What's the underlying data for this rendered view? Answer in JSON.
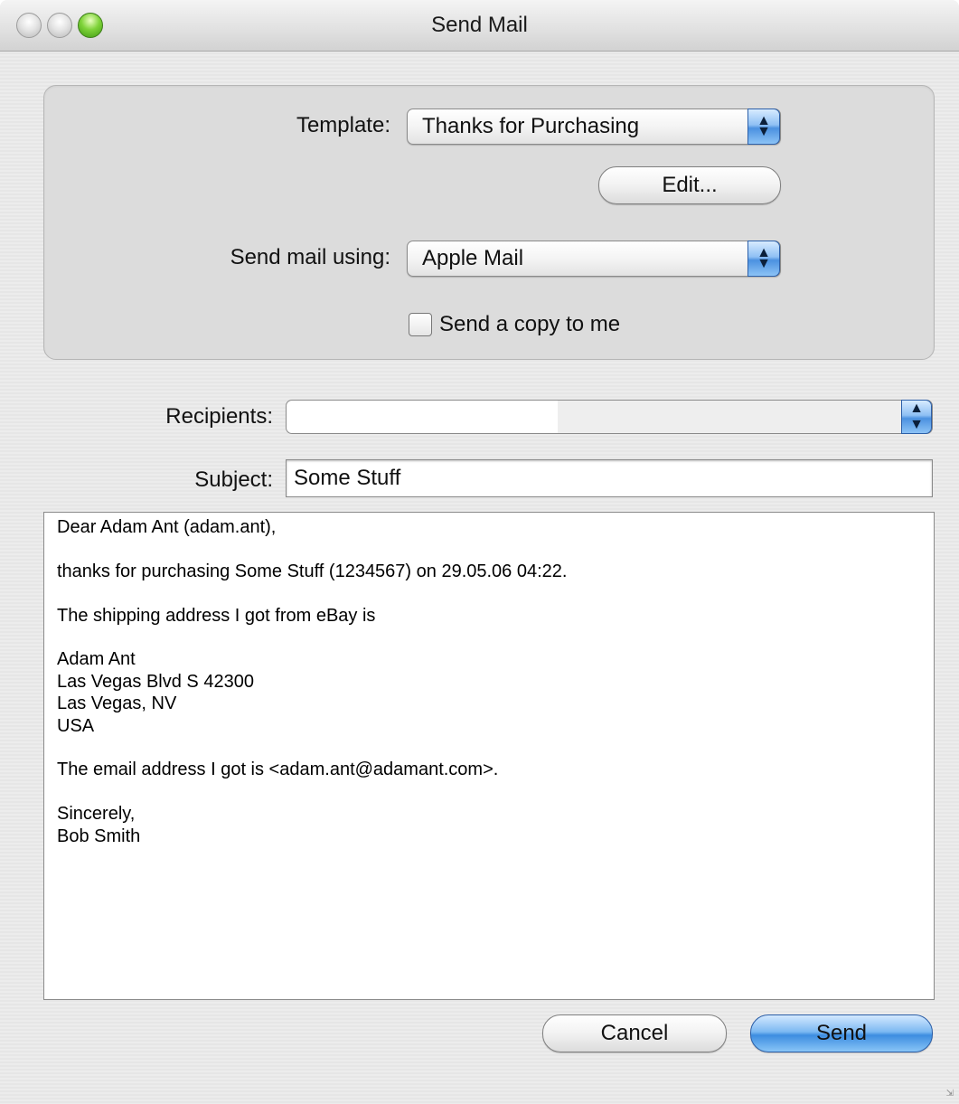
{
  "window": {
    "title": "Send Mail"
  },
  "settings": {
    "template_label": "Template:",
    "template_value": "Thanks for Purchasing",
    "edit_button": "Edit...",
    "send_using_label": "Send mail using:",
    "send_using_value": "Apple Mail",
    "copy_label": "Send a copy to me",
    "copy_checked": false
  },
  "recipients": {
    "label": "Recipients:",
    "value": ""
  },
  "subject": {
    "label": "Subject:",
    "value": "Some Stuff"
  },
  "message": {
    "lines": [
      "Dear Adam Ant (adam.ant),",
      "",
      "thanks for purchasing Some Stuff (1234567) on 29.05.06 04:22.",
      "",
      "The shipping address I got from eBay is",
      "",
      "Adam Ant",
      "Las Vegas Blvd S 42300",
      "Las Vegas, NV",
      "USA",
      "",
      "The email address I got is <adam.ant@adamant.com>.",
      "",
      "Sincerely,",
      "Bob Smith"
    ]
  },
  "buttons": {
    "cancel": "Cancel",
    "send": "Send"
  }
}
